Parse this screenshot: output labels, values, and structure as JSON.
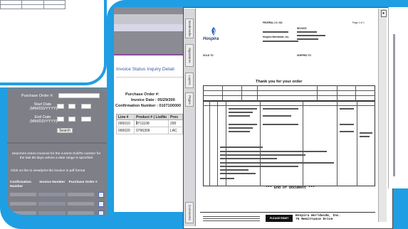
{
  "colors": {
    "frame_blue": "#1f9ee3",
    "panel_gray": "#7f8087",
    "link_blue": "#3b56a6"
  },
  "search_form": {
    "purchase_order_label": "Purchase Order #:",
    "start_date_label": "Start Date (MM/DD/YYYY)",
    "end_date_label": "End Date (MM/DD/YYYY)",
    "search_button": "Search",
    "note": "Searches return invoices for the current SoldTo number for the last 90 days unless a date range is specified",
    "pdf_hint": "Click on the  to view/print the invoice in pdf format",
    "result_columns": [
      "Confirmation Number",
      "Invoice Number",
      "Purchase Order #"
    ]
  },
  "invoice_detail": {
    "title": "Invoice Status Inquiry Detail",
    "purchase_order_label": "Purchase Order #:",
    "invoice_date": "Invoice Date : 05/29/200",
    "confirmation": "Confirmation Number : 0107100000",
    "columns": [
      "Line #",
      "Product # ( ListNo )",
      "Proc"
    ],
    "rows": [
      {
        "line": "000010",
        "product": "0711108",
        "desc": "200"
      },
      {
        "line": "000020",
        "product": "0796309",
        "desc": "LAC"
      }
    ]
  },
  "viewer": {
    "side_tabs": [
      "Bookmarks",
      "Signatures",
      "Layers",
      "Pages",
      "Comments"
    ],
    "arrow": "▸"
  },
  "document": {
    "company": "Hospira",
    "company_tag": "Hospira Worldwide, Inc.",
    "page_label": "Page 1 of 1",
    "invoice_header": "INVOICE",
    "federal_id": "FEDERAL I.D. NO.",
    "thank_you": "Thank you for your order",
    "sold_to": "SOLD TO",
    "ship_to": "SHIPPED TO",
    "end_of_document": "*** End of Document ***",
    "footer_notice": "PLEASE REMIT",
    "footer_address": "Hospira Worldwide, Inc.\n75 Remittance Drive"
  }
}
